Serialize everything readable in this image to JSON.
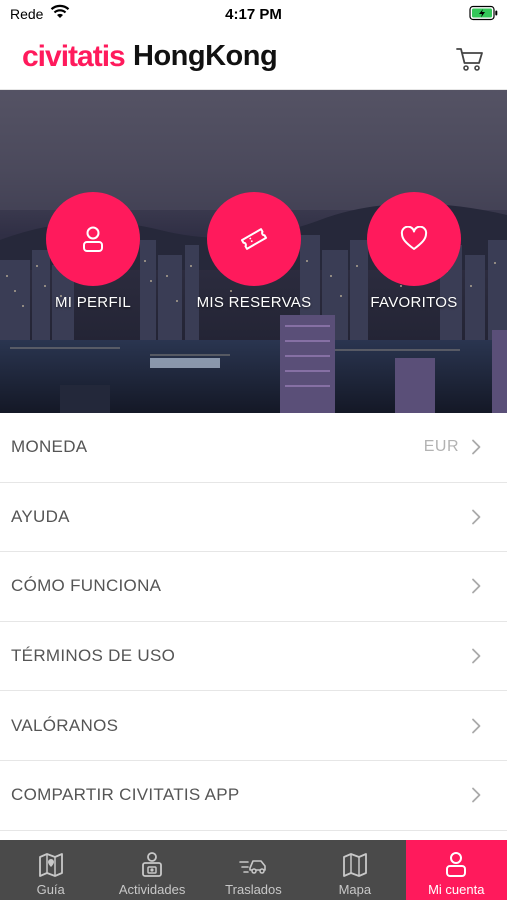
{
  "status_bar": {
    "carrier": "Rede",
    "time": "4:17 PM"
  },
  "header": {
    "brand": "civitatis",
    "city": "HongKong",
    "cart_icon": "cart-icon"
  },
  "hero": {
    "actions": [
      {
        "label": "MI PERFIL",
        "icon": "user-icon"
      },
      {
        "label": "MIS RESERVAS",
        "icon": "ticket-icon"
      },
      {
        "label": "FAVORITOS",
        "icon": "heart-icon"
      }
    ]
  },
  "menu": {
    "items": [
      {
        "label": "MONEDA",
        "value": "EUR"
      },
      {
        "label": "AYUDA",
        "value": ""
      },
      {
        "label": "CÓMO FUNCIONA",
        "value": ""
      },
      {
        "label": "TÉRMINOS DE USO",
        "value": ""
      },
      {
        "label": "VALÓRANOS",
        "value": ""
      },
      {
        "label": "COMPARTIR CIVITATIS APP",
        "value": ""
      }
    ]
  },
  "tabbar": {
    "tabs": [
      {
        "label": "Guía",
        "icon": "map-guide-icon"
      },
      {
        "label": "Actividades",
        "icon": "activities-icon"
      },
      {
        "label": "Traslados",
        "icon": "transfers-icon"
      },
      {
        "label": "Mapa",
        "icon": "map-icon"
      },
      {
        "label": "Mi cuenta",
        "icon": "account-icon"
      }
    ],
    "active_index": 4
  },
  "colors": {
    "accent": "#ff1a5c",
    "tabbar_bg": "#4a4a4a",
    "text": "#555555",
    "value": "#b3b3b3"
  }
}
